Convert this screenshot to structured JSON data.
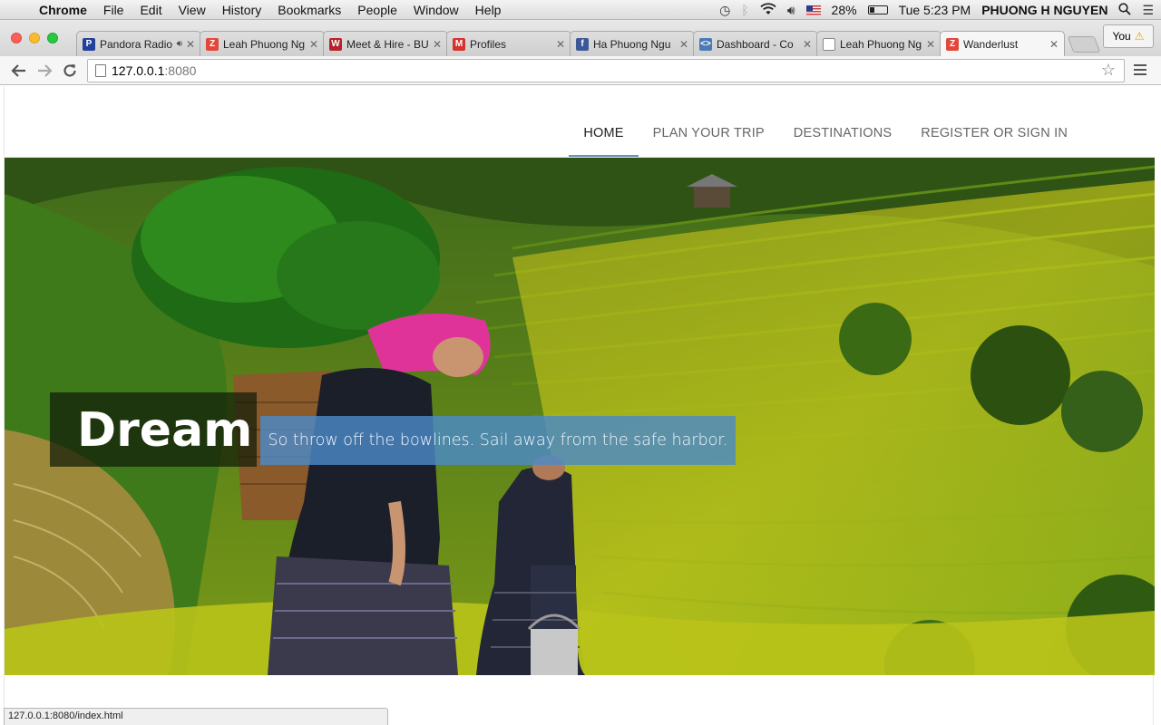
{
  "menubar": {
    "app": "Chrome",
    "items": [
      "File",
      "Edit",
      "View",
      "History",
      "Bookmarks",
      "People",
      "Window",
      "Help"
    ],
    "battery": "28%",
    "battery_level": 0.28,
    "clock": "Tue 5:23 PM",
    "user": "PHUONG H NGUYEN"
  },
  "tabs": [
    {
      "label": "Pandora Radio",
      "icon": "pandora-icon",
      "color": "#224099",
      "glyph": "P"
    },
    {
      "label": "Leah Phuong Ng",
      "icon": "zerply-icon",
      "color": "#e2473b",
      "glyph": "Z"
    },
    {
      "label": "Meet & Hire - BU",
      "icon": "w-icon",
      "color": "#b5242a",
      "glyph": "W"
    },
    {
      "label": "Profiles",
      "icon": "profiles-icon",
      "color": "#d6332d",
      "glyph": "M"
    },
    {
      "label": "Ha Phuong Ngu",
      "icon": "facebook-icon",
      "color": "#3b5998",
      "glyph": "f"
    },
    {
      "label": "Dashboard - Co",
      "icon": "code-icon",
      "color": "#4a7bb5",
      "glyph": "<>"
    },
    {
      "label": "Leah Phuong Ng",
      "icon": "page-icon",
      "color": "#888888",
      "glyph": ""
    },
    {
      "label": "Wanderlust",
      "icon": "zerply-icon",
      "color": "#e2473b",
      "glyph": "Z"
    }
  ],
  "profile": {
    "label": "You"
  },
  "address": {
    "host": "127.0.0.1",
    "port": ":8080"
  },
  "site": {
    "nav": [
      "HOME",
      "PLAN YOUR TRIP",
      "DESTINATIONS",
      "REGISTER OR SIGN IN"
    ],
    "hero_title": "Dream",
    "hero_quote": "So throw off the bowlines. Sail away from the safe harbor."
  },
  "status_url": "127.0.0.1:8080/index.html"
}
